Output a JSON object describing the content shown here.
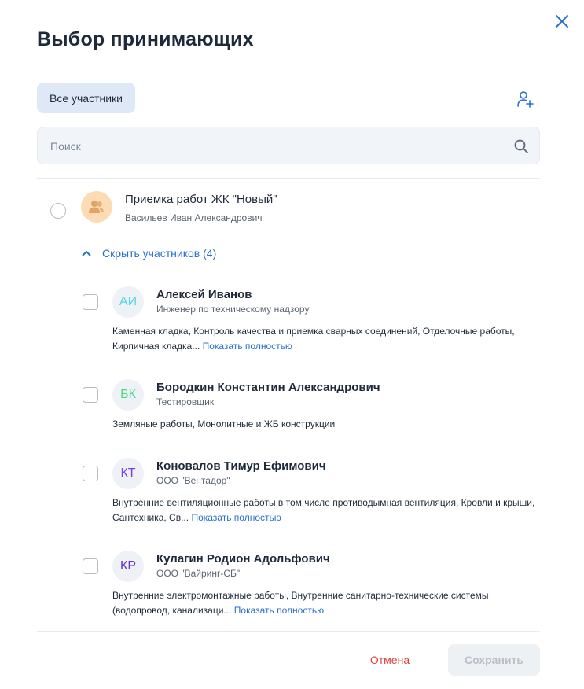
{
  "dialog": {
    "title": "Выбор принимающих",
    "filter_chip": "Все участники",
    "search": {
      "placeholder": "Поиск",
      "value": ""
    }
  },
  "group": {
    "name": "Приемка работ ЖК \"Новый\"",
    "owner": "Васильев Иван Александрович",
    "toggle_label": "Скрыть участников (4)",
    "avatar_color": "#fddcb5"
  },
  "members": [
    {
      "initials": "АИ",
      "initials_color": "#4fd6e8",
      "name": "Алексей Иванов",
      "role": "Инженер по техническому надзору",
      "desc": "Каменная кладка, Контроль качества и приемка сварных соединений, Отделочные работы, Кирпичная кладка...",
      "show_more": "Показать полностью"
    },
    {
      "initials": "БК",
      "initials_color": "#4cd98a",
      "name": "Бородкин Константин Александрович",
      "role": "Тестировщик",
      "desc": "Земляные работы, Монолитные и ЖБ конструкции",
      "show_more": ""
    },
    {
      "initials": "КТ",
      "initials_color": "#7b3fe4",
      "name": "Коновалов Тимур Ефимович",
      "role": "ООО \"Вентадор\"",
      "desc": "Внутренние вентиляционные работы в том числе противодымная вентиляция, Кровли и крыши, Сантехника, Св...",
      "show_more": "Показать полностью"
    },
    {
      "initials": "КР",
      "initials_color": "#6a2fd6",
      "name": "Кулагин Родион Адольфович",
      "role": "ООО \"Вайринг-СБ\"",
      "desc": "Внутренние электромонтажные работы, Внутренние санитарно-технические системы (водопровод, канализаци...",
      "show_more": "Показать полностью"
    }
  ],
  "footer": {
    "cancel_label": "Отмена",
    "save_label": "Сохранить"
  },
  "colors": {
    "accent": "#2a6fd1",
    "danger": "#e03d3d",
    "chip_bg": "#dfe8f6"
  }
}
